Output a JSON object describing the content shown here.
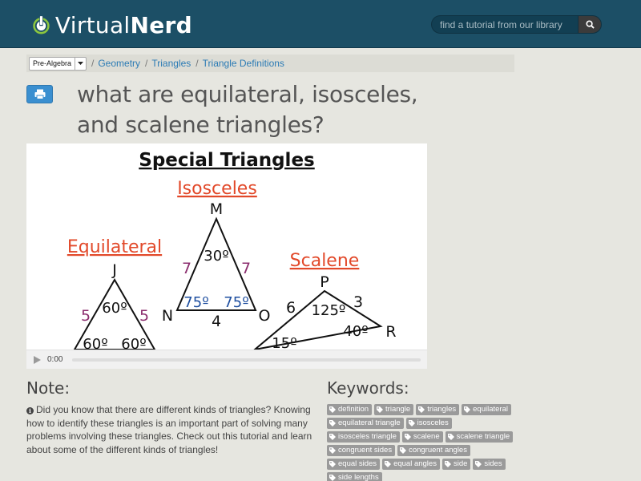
{
  "header": {
    "logo_word1": "Virtual",
    "logo_word2": "Nerd",
    "search_placeholder": "find a tutorial from our library"
  },
  "breadcrumb": {
    "subject": "Pre-Algebra",
    "items": [
      "Geometry",
      "Triangles",
      "Triangle Definitions"
    ]
  },
  "page_title": "what are equilateral, isosceles, and scalene triangles?",
  "video": {
    "time": "0:00",
    "slide": {
      "heading": "Special Triangles",
      "isosceles": {
        "label": "Isosceles",
        "vertices": [
          "M",
          "N",
          "O"
        ],
        "sides": [
          "7",
          "7",
          "4"
        ],
        "angles": [
          "30º",
          "75º",
          "75º"
        ]
      },
      "equilateral": {
        "label": "Equilateral",
        "vertices": [
          "J"
        ],
        "sides": [
          "5",
          "5"
        ],
        "angles": [
          "60º",
          "60º",
          "60º"
        ]
      },
      "scalene": {
        "label": "Scalene",
        "vertices": [
          "P",
          "R"
        ],
        "sides": [
          "6",
          "3"
        ],
        "angles": [
          "125º",
          "40º",
          "15º"
        ]
      }
    }
  },
  "note": {
    "heading": "Note:",
    "text": "Did you know that there are different kinds of triangles? Knowing how to identify these triangles is an important part of solving many problems involving these triangles. Check out this tutorial and learn about some of the different kinds of triangles!"
  },
  "keywords": {
    "heading": "Keywords:",
    "tags": [
      "definition",
      "triangle",
      "triangles",
      "equilateral",
      "equilateral triangle",
      "isosceles",
      "isosceles triangle",
      "scalene",
      "scalene triangle",
      "congruent sides",
      "congruent angles",
      "equal sides",
      "equal angles",
      "side",
      "sides",
      "side lengths"
    ]
  },
  "colors": {
    "header_bg": "#1c4f66",
    "logo_green": "#8cc63f",
    "link_blue": "#2b7bb5",
    "print_button": "#3a8fd0",
    "slide_red": "#e2492a",
    "slide_purple": "#8b2d6e",
    "slide_blue": "#1f4fa0",
    "tag_bg": "#9a9a9a"
  },
  "icons": {
    "search": "search-icon",
    "print": "printer-icon",
    "play": "play-icon",
    "info": "info-icon",
    "tag": "tag-icon",
    "dropdown": "caret-down-icon"
  }
}
